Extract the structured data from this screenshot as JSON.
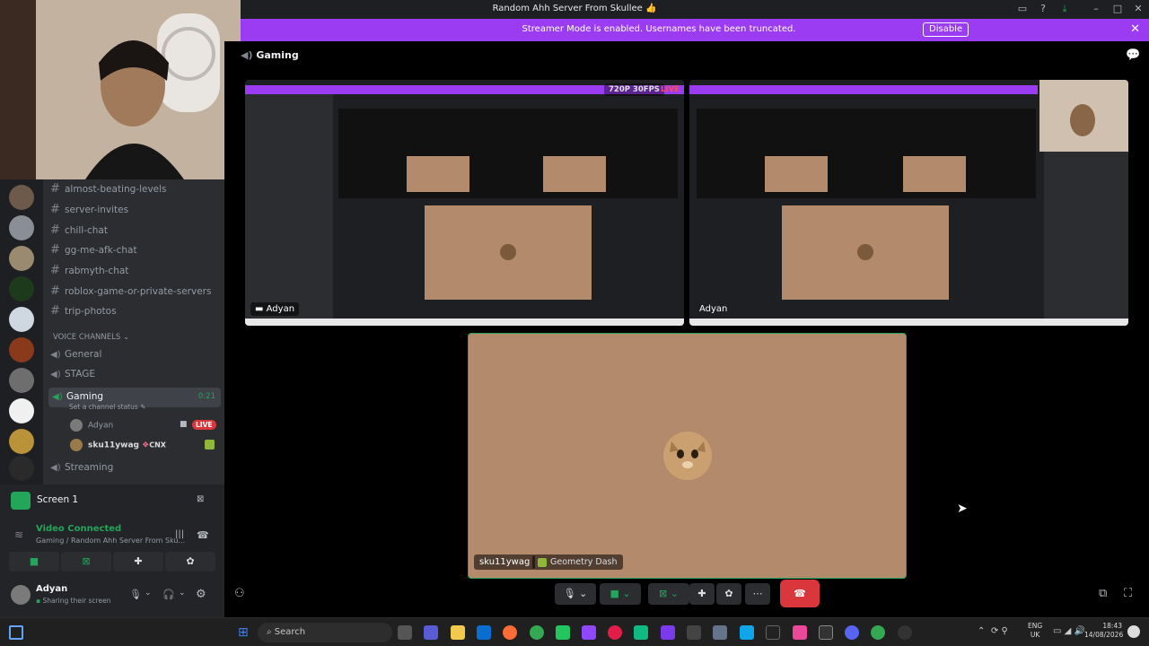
{
  "window": {
    "title": "Random Ahh Server From Skullee 👍"
  },
  "banner": {
    "message": "Streamer Mode is enabled. Usernames have been truncated.",
    "button": "Disable"
  },
  "channel_header": {
    "name": "Gaming"
  },
  "text_channels": [
    "almost-beating-levels",
    "server-invites",
    "chill-chat",
    "gg-me-afk-chat",
    "rabmyth-chat",
    "roblox-game-or-private-servers",
    "trip-photos"
  ],
  "voice_section": {
    "label": "VOICE CHANNELS"
  },
  "voice_channels": {
    "general": "General",
    "stage": "STAGE",
    "gaming": {
      "name": "Gaming",
      "time": "0:21",
      "status": "Set a channel status"
    },
    "streaming": "Streaming"
  },
  "members": [
    {
      "name": "Adyan",
      "live": "LIVE"
    },
    {
      "name": "sku11ywag",
      "tag": "CNX"
    }
  ],
  "screen_share": {
    "label": "Screen 1"
  },
  "connection": {
    "status": "Video Connected",
    "location": "Gaming / Random Ahh Server From Sku..."
  },
  "user": {
    "name": "Adyan",
    "status": "Sharing their screen"
  },
  "stream_tiles": [
    {
      "name": "Adyan",
      "quality": "720P 30FPS",
      "live": "LIVE"
    },
    {
      "name": "Adyan"
    }
  ],
  "main_tile": {
    "name": "sku11ywag",
    "activity": "Geometry Dash"
  },
  "taskbar": {
    "search": "Search",
    "lang1": "ENG",
    "lang2": "UK",
    "time": "18:43",
    "date": "14/08/2026"
  },
  "colors": {
    "accent": "#9b3cf2",
    "live": "#da373c",
    "green": "#23a55a",
    "tile": "#b48a6c"
  }
}
